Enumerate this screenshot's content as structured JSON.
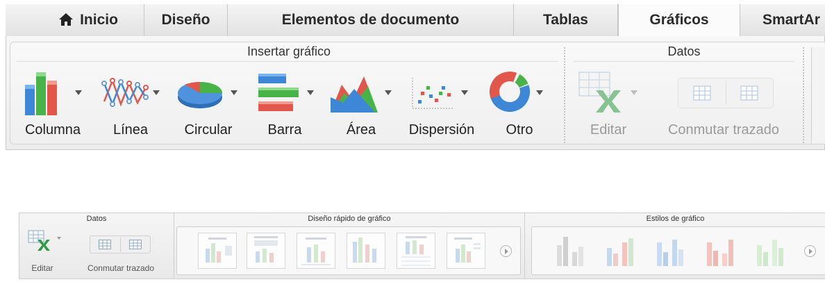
{
  "ribbon": {
    "tabs": [
      {
        "label": "Inicio",
        "icon": "home-icon"
      },
      {
        "label": "Diseño"
      },
      {
        "label": "Elementos de documento"
      },
      {
        "label": "Tablas"
      },
      {
        "label": "Gráficos"
      },
      {
        "label": "SmartAr"
      }
    ],
    "active_tab": "Gráficos",
    "groups": {
      "insert_chart": {
        "title": "Insertar gráfico",
        "buttons": [
          {
            "label": "Columna",
            "icon": "column-chart-icon"
          },
          {
            "label": "Línea",
            "icon": "line-chart-icon"
          },
          {
            "label": "Circular",
            "icon": "pie-chart-icon"
          },
          {
            "label": "Barra",
            "icon": "bar-chart-icon"
          },
          {
            "label": "Área",
            "icon": "area-chart-icon"
          },
          {
            "label": "Dispersión",
            "icon": "scatter-chart-icon"
          },
          {
            "label": "Otro",
            "icon": "doughnut-chart-icon"
          }
        ]
      },
      "data": {
        "title": "Datos",
        "buttons": [
          {
            "label": "Editar",
            "icon": "edit-data-icon",
            "enabled": false
          },
          {
            "label": "Conmutar trazado",
            "icon": "switch-plot-icon",
            "enabled": false
          }
        ]
      }
    }
  },
  "mini_ribbon": {
    "groups": {
      "data": {
        "title": "Datos",
        "buttons": [
          {
            "label": "Editar"
          },
          {
            "label": "Conmutar trazado"
          }
        ]
      },
      "quick_layout": {
        "title": "Diseño rápido de gráfico"
      },
      "chart_styles": {
        "title": "Estilos de gráfico"
      }
    }
  },
  "colors": {
    "column_blue": "#3e86d6",
    "column_green": "#47b348",
    "column_red": "#e2574c",
    "disabled_text": "#9a9a9a"
  }
}
